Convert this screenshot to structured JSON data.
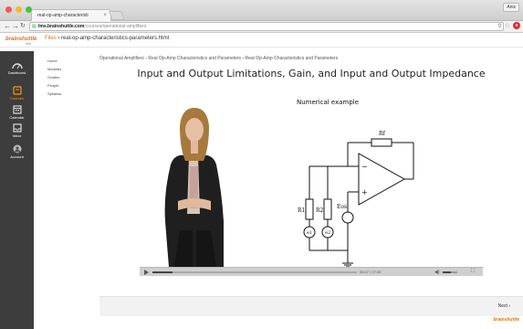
{
  "browser": {
    "tab_title": "real-op-amp-characteristi",
    "profile": "Anis",
    "url_domain": "lms.brainshuttle.com",
    "url_path": "/courses/operational-amplifiers"
  },
  "brand": {
    "logo": "brainshuttle",
    "logo_sub": "lms"
  },
  "file_crumb": {
    "files": "Files",
    "separator": "›",
    "filename": "real-op-amp-characteristics-parameters.html"
  },
  "leftnav": {
    "items": [
      {
        "label": "Dashboard",
        "icon": "speedometer-icon"
      },
      {
        "label": "Courses",
        "icon": "book-icon"
      },
      {
        "label": "Calendar",
        "icon": "calendar-icon"
      },
      {
        "label": "Inbox",
        "icon": "inbox-icon"
      },
      {
        "label": "Account",
        "icon": "account-icon"
      }
    ],
    "active": "Courses"
  },
  "subnav": {
    "items": [
      "Home",
      "Modules",
      "Grades",
      "People",
      "Syllabus"
    ]
  },
  "breadcrumb": "Operational Amplifiers › Real Op-Amp Characteristics and Parameters › Real Op-Amp Characteristics and Parameters",
  "lecture": {
    "title": "Input and Output Limitations, Gain, and Input and Output Impedance",
    "numerical_example": "Numerical example",
    "circuit_labels": {
      "rf": "Rf",
      "r1": "R1",
      "r2": "R2",
      "eos": "Eos",
      "e1": "e1",
      "e2": "e2",
      "minus": "−",
      "plus": "+"
    }
  },
  "player": {
    "time": "00:07 / 07:45",
    "progress": 0.1,
    "volume": 0.55
  },
  "footer": {
    "next": "Next ›",
    "logo": "brainshuttle"
  },
  "colors": {
    "accent": "#e07010",
    "nav_bg": "#3d3d3d",
    "active": "#f39c12"
  }
}
